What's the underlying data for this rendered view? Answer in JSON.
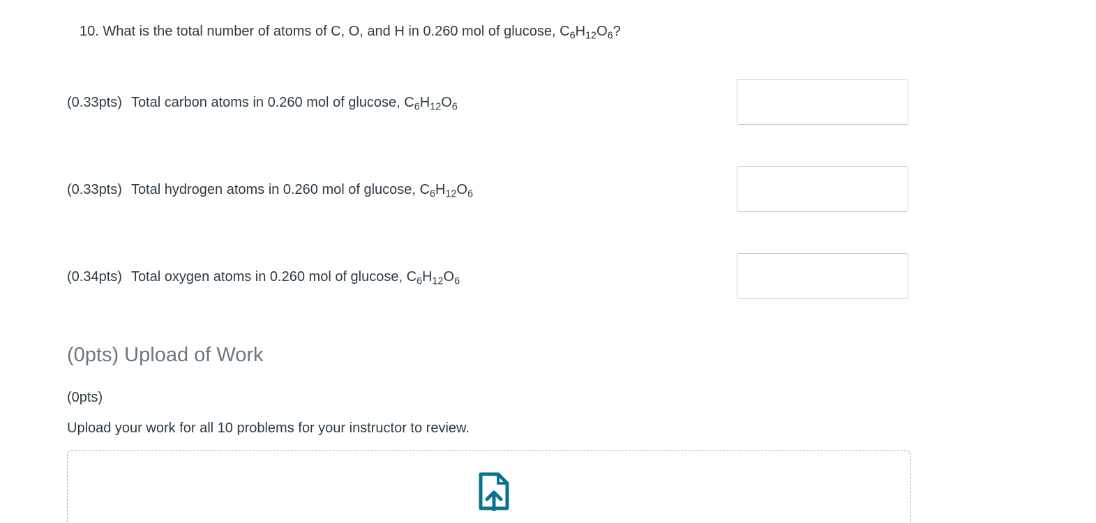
{
  "question": {
    "number_text": "10. What is the total number of atoms of C, O, and H in 0.260 mol of glucose, ",
    "formula": {
      "c": "C",
      "c_sub": "6",
      "h": "H",
      "h_sub": "12",
      "o": "O",
      "o_sub": "6"
    },
    "suffix": "?"
  },
  "parts": [
    {
      "points": "(0.33pts)",
      "text": "Total carbon atoms in 0.260 mol of glucose, ",
      "input_value": ""
    },
    {
      "points": "(0.33pts)",
      "text": "Total hydrogen atoms in 0.260 mol of glucose, ",
      "input_value": ""
    },
    {
      "points": "(0.34pts)",
      "text": "Total oxygen atoms in 0.260 mol of glucose, ",
      "input_value": ""
    }
  ],
  "upload": {
    "heading": "(0pts) Upload of Work",
    "points": "(0pts)",
    "instructions": "Upload your work for all 10 problems for your instructor to review.",
    "icon": "file-upload-icon",
    "icon_color": "#0a7490"
  }
}
